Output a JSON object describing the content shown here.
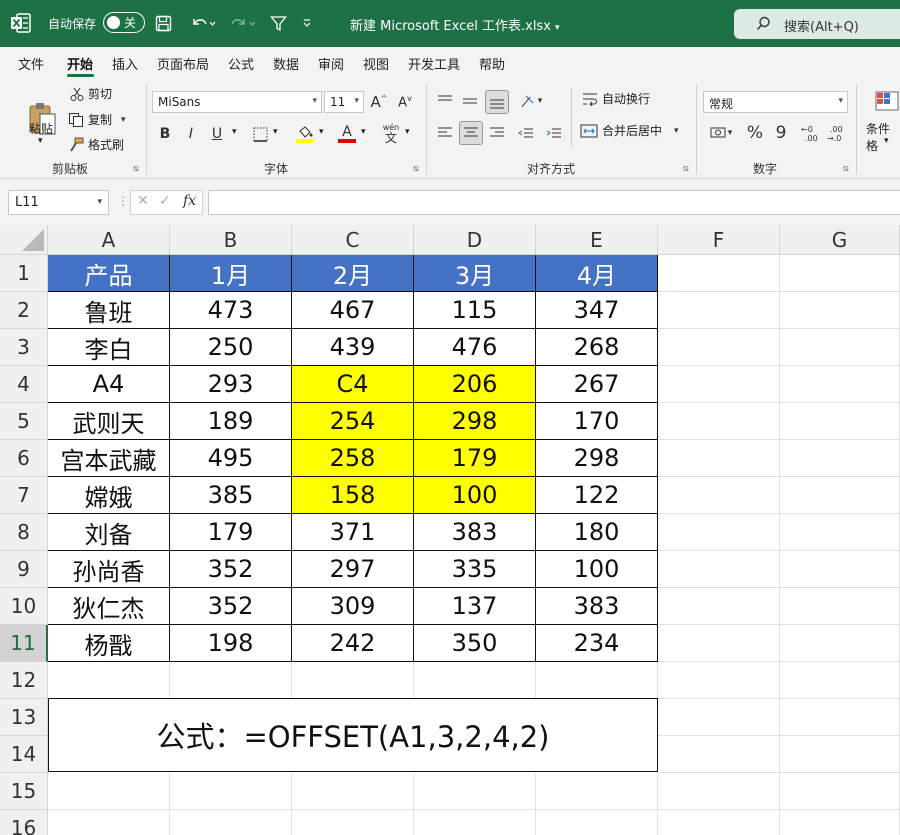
{
  "titlebar": {
    "autosave_label": "自动保存",
    "autosave_state": "关",
    "doc_title": "新建 Microsoft Excel 工作表.xlsx",
    "search_placeholder": "搜索(Alt+Q)"
  },
  "menu": [
    "文件",
    "开始",
    "插入",
    "页面布局",
    "公式",
    "数据",
    "审阅",
    "视图",
    "开发工具",
    "帮助"
  ],
  "menu_active": "开始",
  "ribbon": {
    "clipboard": {
      "paste": "粘贴",
      "cut": "剪切",
      "copy": "复制",
      "format_painter": "格式刷",
      "label": "剪贴板"
    },
    "font": {
      "font_name": "MiSans",
      "font_size": "11",
      "bold": "B",
      "italic": "I",
      "underline": "U",
      "phonetic": "wén",
      "label": "字体"
    },
    "alignment": {
      "wrap_text": "自动换行",
      "merge_center": "合并后居中",
      "label": "对齐方式"
    },
    "number": {
      "format": "常规",
      "percent": "%",
      "comma": "9",
      "label": "数字"
    },
    "styles": {
      "conditional": "条件格"
    }
  },
  "formula_bar": {
    "name_box": "L11",
    "fx": "fx",
    "formula": ""
  },
  "columns": [
    "A",
    "B",
    "C",
    "D",
    "E",
    "F",
    "G"
  ],
  "rows": [
    "1",
    "2",
    "3",
    "4",
    "5",
    "6",
    "7",
    "8",
    "9",
    "10",
    "11",
    "12",
    "13",
    "14",
    "15",
    "16"
  ],
  "selected_row": "11",
  "table": {
    "header": [
      "产品",
      "1月",
      "2月",
      "3月",
      "4月"
    ],
    "rows": [
      [
        "鲁班",
        "473",
        "467",
        "115",
        "347"
      ],
      [
        "李白",
        "250",
        "439",
        "476",
        "268"
      ],
      [
        "A4",
        "293",
        "C4",
        "206",
        "267"
      ],
      [
        "武则天",
        "189",
        "254",
        "298",
        "170"
      ],
      [
        "宫本武藏",
        "495",
        "258",
        "179",
        "298"
      ],
      [
        "嫦娥",
        "385",
        "158",
        "100",
        "122"
      ],
      [
        "刘备",
        "179",
        "371",
        "383",
        "180"
      ],
      [
        "孙尚香",
        "352",
        "297",
        "335",
        "100"
      ],
      [
        "狄仁杰",
        "352",
        "309",
        "137",
        "383"
      ],
      [
        "杨戬",
        "198",
        "242",
        "350",
        "234"
      ]
    ]
  },
  "formula_note": "公式：=OFFSET(A1,3,2,4,2)",
  "colors": {
    "accent": "#1e7145",
    "header_fill": "#4472c4",
    "highlight": "#ffff00"
  }
}
